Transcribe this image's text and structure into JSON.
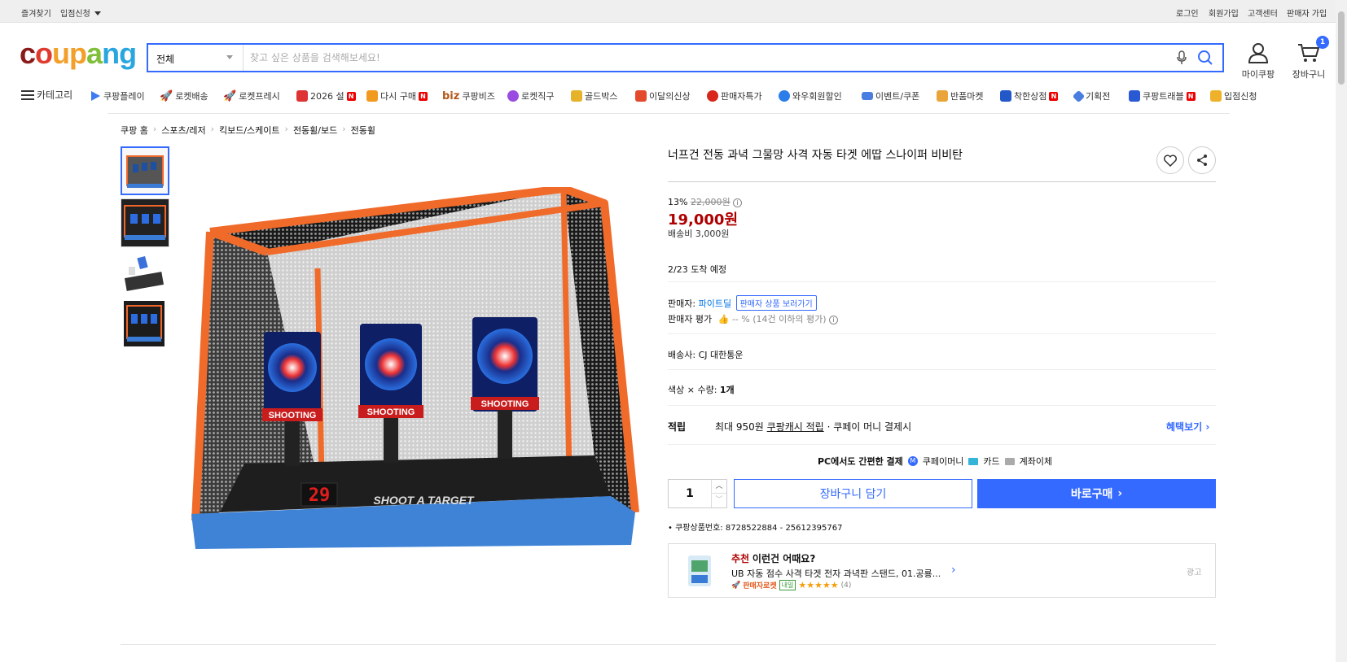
{
  "topbar": {
    "favorites": "즐겨찾기",
    "seller_apply": "입점신청",
    "login": "로그인",
    "signup": "회원가입",
    "customer_center": "고객센터",
    "seller_signup": "판매자 가입"
  },
  "header": {
    "logo": {
      "c": "c",
      "o": "o",
      "u": "u",
      "p": "p",
      "a": "a",
      "n": "n",
      "g": "g"
    },
    "search_category": "전체",
    "search_placeholder": "찾고 싶은 상품을 검색해보세요!",
    "mycoupang": "마이쿠팡",
    "cart": "장바구니",
    "cart_count": "1"
  },
  "category_bar": {
    "menu_label": "카테고리",
    "items": [
      "쿠팡플레이",
      "로켓배송",
      "로켓프레시",
      "2026 설",
      "다시 구매",
      "쿠팡비즈",
      "로켓직구",
      "골드박스",
      "이달의신상",
      "판매자특가",
      "와우회원할인",
      "이벤트/쿠폰",
      "반품마켓",
      "착한상점",
      "기획전",
      "쿠팡트래블",
      "입점신청"
    ],
    "biz_prefix": "biz"
  },
  "breadcrumb": [
    "쿠팡 홈",
    "스포츠/레저",
    "킥보드/스케이트",
    "전동휠/보드",
    "전동휠"
  ],
  "product": {
    "title": "너프건 전동 과녁 그물망 사격 자동 타겟 에땁 스나이퍼 비비탄",
    "discount_rate": "13%",
    "original_price": "22,000원",
    "price": "19,000원",
    "shipping_fee": "배송비 3,000원",
    "arrival": "2/23 도착 예정",
    "seller_label": "판매자:",
    "seller_name": "파이트딜",
    "seller_products_btn": "판매자 상품 보러가기",
    "seller_rating_label": "판매자 평가",
    "seller_rating_value": "-- % (14건 이하의 평가)",
    "carrier_label": "배송사:",
    "carrier": "CJ 대한통운",
    "option_label": "색상 × 수량:",
    "option_value": "1개",
    "reward_label": "적립",
    "reward_text_1": "최대 950원",
    "reward_link": "쿠팡캐시 적립",
    "reward_text_2": "· 쿠페이 머니 결제시",
    "benefit_link": "혜택보기",
    "pc_pay_title": "PC에서도 간편한 결제",
    "pay_methods": [
      "쿠페이머니",
      "카드",
      "계좌이체"
    ],
    "quantity": "1",
    "add_to_cart": "장바구니 담기",
    "buy_now": "바로구매",
    "product_number_label": "쿠팡상품번호:",
    "product_number": "8728522884 - 25612395767"
  },
  "recommend": {
    "tag": "추천",
    "title": "이런건 어때요?",
    "item_name": "UB 자동 점수 사격 타겟 전자 과녁판 스탠드, 01.공룡...",
    "badge_rocket": "판매자로켓",
    "badge_tomorrow": "내일",
    "stars": "★★★★★",
    "review_count": "(4)",
    "ad_label": "광고"
  },
  "image_text": {
    "score": "29",
    "target_label": "SHOOTING",
    "base_label": "SHOOT A TARGET"
  },
  "colors": {
    "brand_blue": "#346aff",
    "price_red": "#ae0000",
    "link_blue": "#0073e9"
  }
}
